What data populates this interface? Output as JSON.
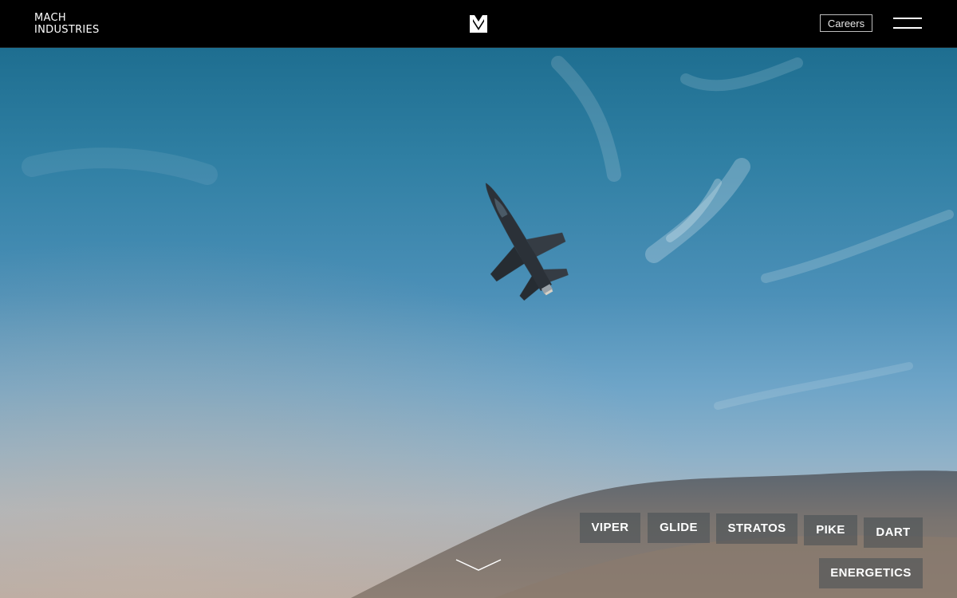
{
  "header": {
    "logo_line1": "MACH",
    "logo_line2": "INDUSTRIES",
    "careers_label": "Careers",
    "brand_icon": "mach-m-logo-icon",
    "menu_icon": "hamburger-menu-icon"
  },
  "hero": {
    "image_subject": "jet-aircraft-in-sky",
    "scroll_icon": "chevron-down-icon"
  },
  "products": [
    "VIPER",
    "GLIDE",
    "STRATOS",
    "PIKE",
    "DART",
    "ENERGETICS"
  ],
  "colors": {
    "topbar": "#000000",
    "sky_top": "#1e6e90",
    "sky_bottom": "#b7aba4",
    "button_bg": "#464e54",
    "text": "#ffffff"
  }
}
